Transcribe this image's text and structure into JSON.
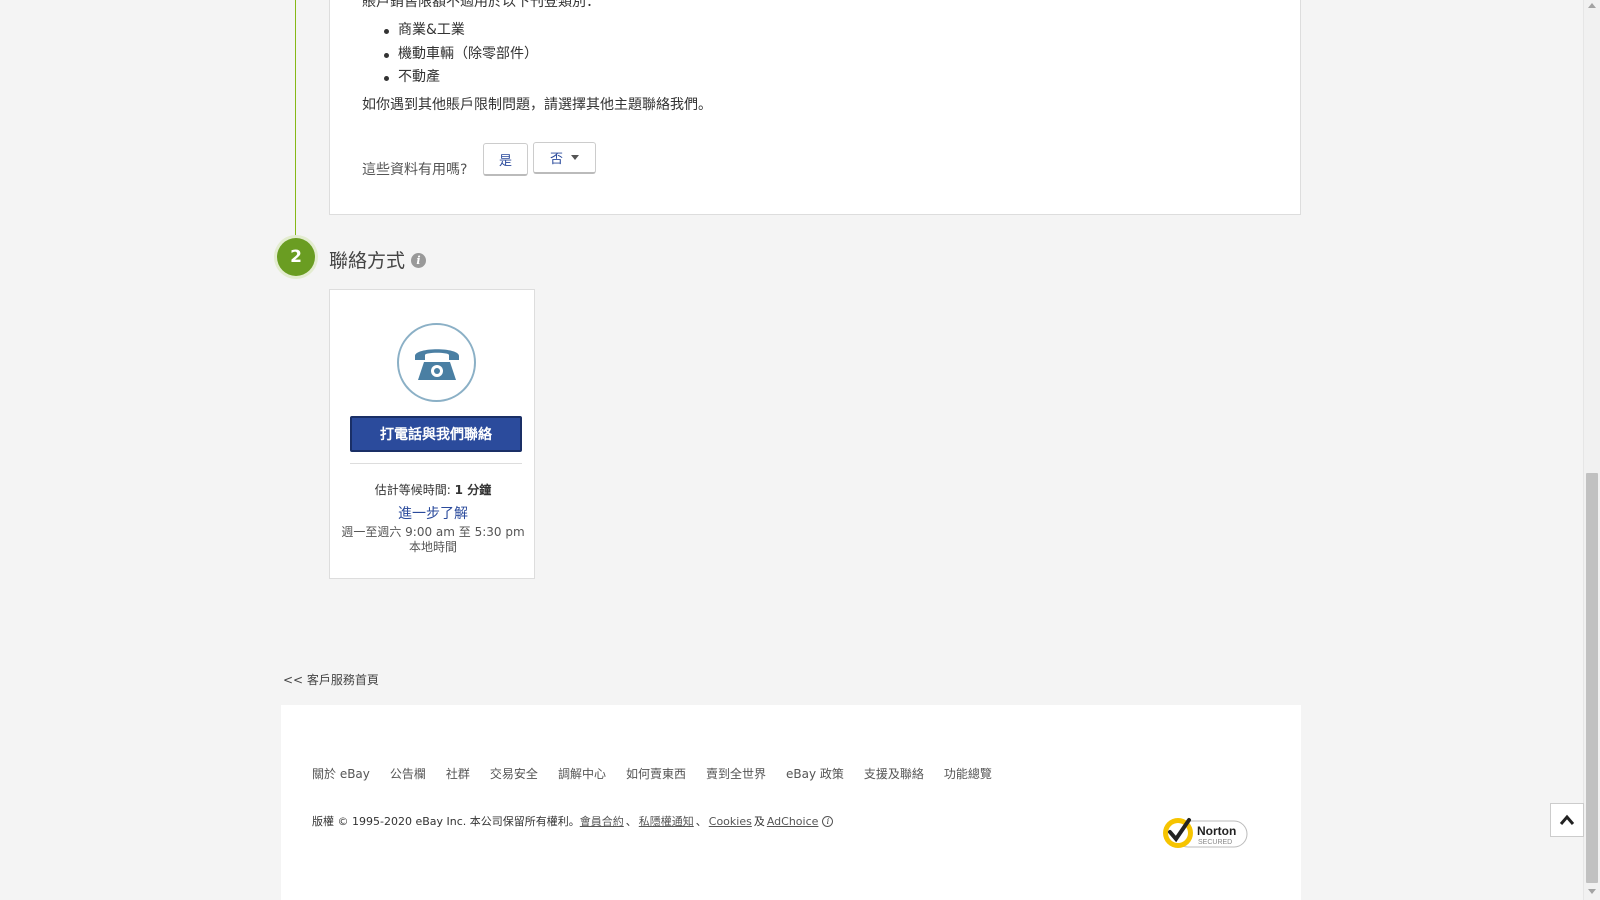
{
  "answer": {
    "intro_text": "賬戶銷售限額不適用於以下刊登類別：",
    "categories": [
      "商業&工業",
      "機動車輛（除零部件）",
      "不動產"
    ],
    "other_issues_text": "如你遇到其他賬戶限制問題，請選擇其他主題聯絡我們。",
    "feedback_question": "這些資料有用嗎?",
    "yes_label": "是",
    "no_label": "否"
  },
  "contact": {
    "step_number": "2",
    "heading": "聯絡方式",
    "info_icon": "i",
    "phone_icon": "phone-icon",
    "call_button_label": "打電話與我們聯絡",
    "wait_label": "估計等候時間:",
    "wait_value": "1 分鐘",
    "learn_more": "進一步了解",
    "hours": "週一至週六 9:00 am 至 5:30 pm",
    "local_time": "本地時間"
  },
  "back_link": "<< 客戶服務首頁",
  "footer": {
    "links": [
      "關於 eBay",
      "公告欄",
      "社群",
      "交易安全",
      "調解中心",
      "如何賣東西",
      "賣到全世界",
      "eBay 政策",
      "支援及聯絡",
      "功能總覽"
    ],
    "copyright_prefix": "版權 © 1995-2020 eBay Inc. 本公司保留所有權利。",
    "user_agreement": "會員合約",
    "privacy": "私隱權通知",
    "cookies": "Cookies",
    "and": "及",
    "adchoice": "AdChoice",
    "norton_brand": "Norton",
    "norton_sub": "SECURED"
  },
  "colors": {
    "step_green": "#6a9d22",
    "button_blue": "#2b4b9c",
    "link_blue": "#2b4b9c"
  }
}
